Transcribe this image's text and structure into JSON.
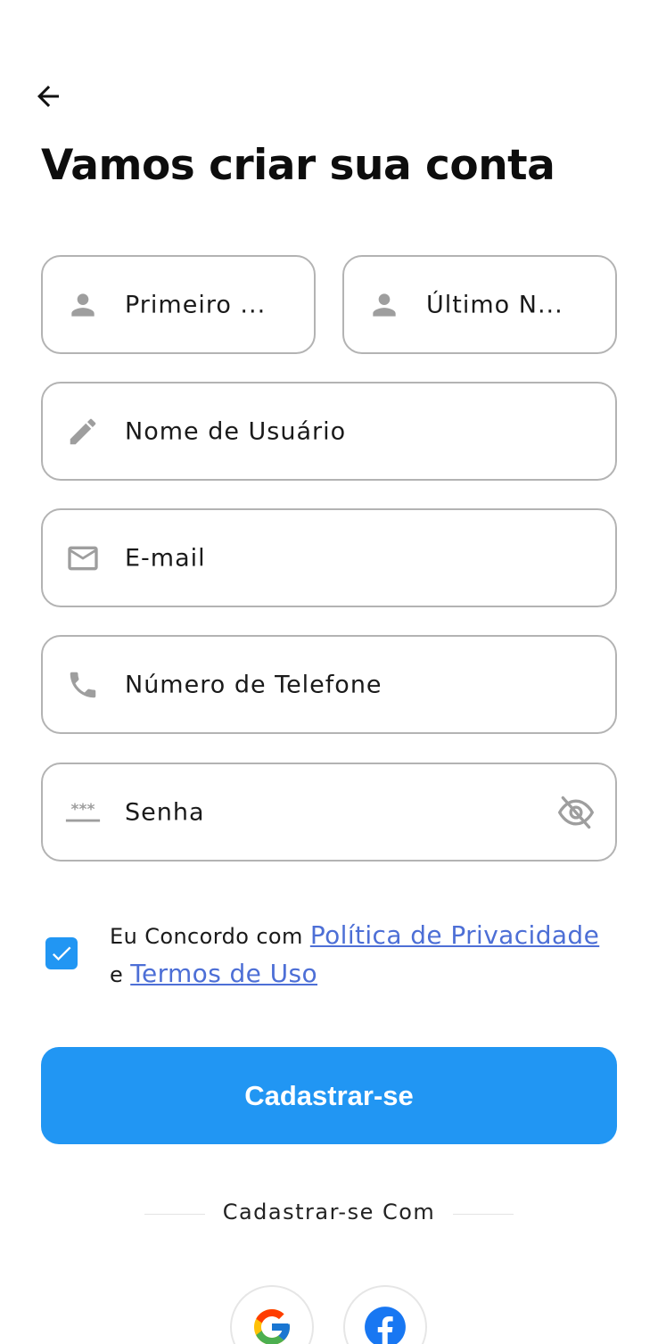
{
  "header": {
    "title": "Vamos criar sua conta"
  },
  "form": {
    "first_name_placeholder": "Primeiro ...",
    "last_name_placeholder": "Último N...",
    "username_placeholder": "Nome de Usuário",
    "email_placeholder": "E-mail",
    "phone_placeholder": "Número de Telefone",
    "password_placeholder": "Senha",
    "password_mask_glyph": "***"
  },
  "agreement": {
    "checked": true,
    "prefix": "Eu Concordo com ",
    "privacy_link": "Política de Privacidade",
    "connector": "e ",
    "terms_link": "Termos de Uso"
  },
  "actions": {
    "signup_label": "Cadastrar-se",
    "signup_with_label": "Cadastrar-se Com"
  },
  "social": [
    {
      "name": "google",
      "icon": "google-icon"
    },
    {
      "name": "facebook",
      "icon": "facebook-icon"
    }
  ],
  "colors": {
    "primary": "#2196f3",
    "link": "#4d6fd6",
    "field_border": "#b3b3b3",
    "icon_gray": "#9e9e9e",
    "facebook_blue": "#1877f2"
  }
}
